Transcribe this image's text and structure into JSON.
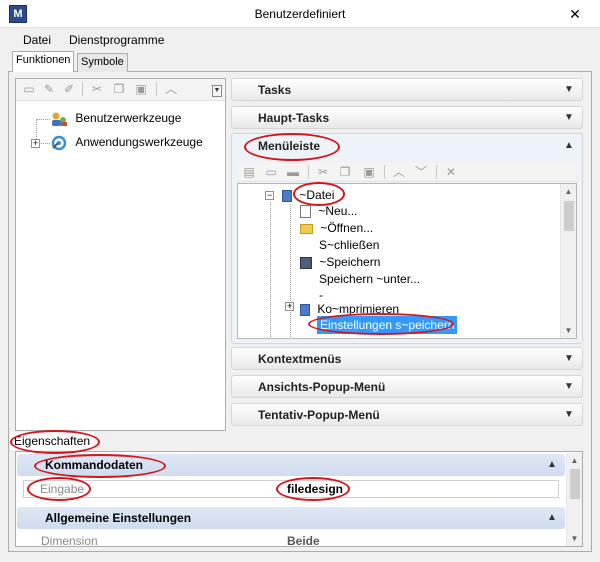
{
  "window": {
    "title": "Benutzerdefiniert",
    "close_glyph": "✕",
    "app_icon_glyph": "M"
  },
  "menubar": {
    "items": [
      "Datei",
      "Dienstprogramme"
    ]
  },
  "tabs": [
    "Funktionen",
    "Symbole"
  ],
  "left_tree": {
    "items": [
      "Benutzerwerkzeuge",
      "Anwendungswerkzeuge"
    ]
  },
  "accordions": {
    "tasks": "Tasks",
    "haupt_tasks": "Haupt-Tasks",
    "menueleiste": "Menüleiste",
    "kontextmenues": "Kontextmenüs",
    "ansichts_popup": "Ansichts-Popup-Menü",
    "tentativ_popup": "Tentativ-Popup-Menü"
  },
  "menu_tree": {
    "root": "~Datei",
    "children": [
      "~Neu...",
      "~Öffnen...",
      "S~chließen",
      "~Speichern",
      "Speichern ~unter...",
      "-",
      "Ko~mprimieren",
      "Einstellungen s~peichern"
    ]
  },
  "properties": {
    "tab_label": "Eigenschaften",
    "section_command": "Kommandodaten",
    "input_label": "Eingabe",
    "input_value": "filedesign",
    "section_general": "Allgemeine Einstellungen",
    "dimension_label": "Dimension",
    "dimension_value": "Beide"
  },
  "colors": {
    "annotation_red": "#d4161b",
    "selection_blue": "#3399ff"
  }
}
